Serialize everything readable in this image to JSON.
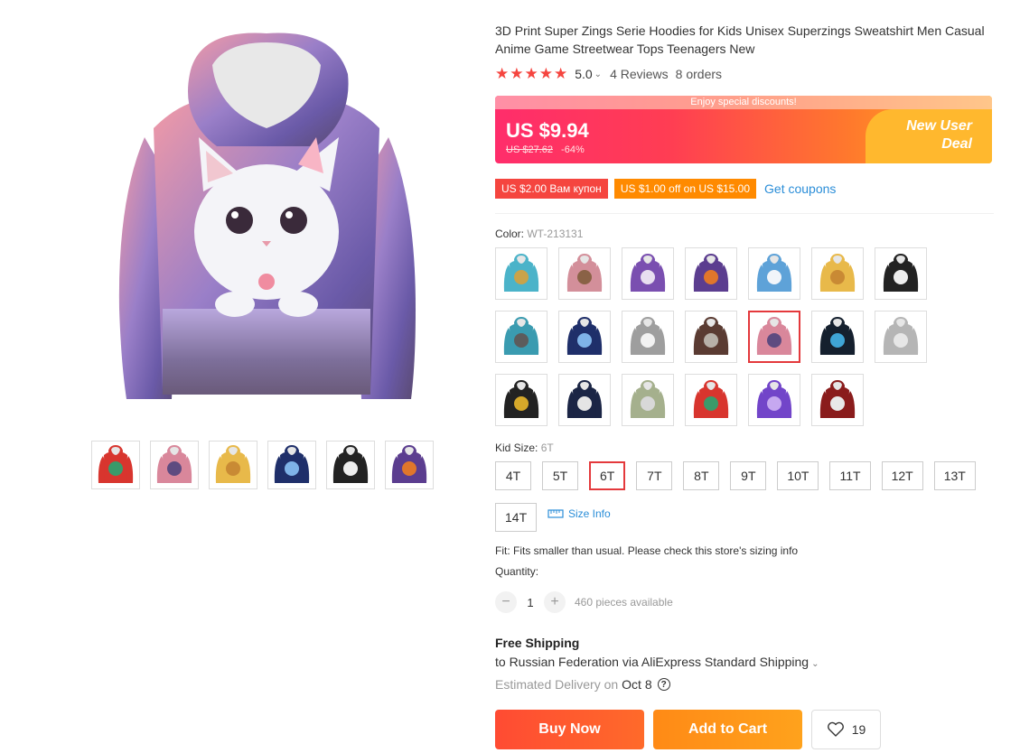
{
  "product": {
    "title": "3D Print Super Zings Serie Hoodies for Kids Unisex Superzings Sweatshirt Men Casual Anime Game Streetwear Tops Teenagers New",
    "rating": "5.0",
    "stars": "★★★★★",
    "reviews": "4 Reviews",
    "orders": "8 orders"
  },
  "promo": {
    "banner_text": "Enjoy special discounts!",
    "price": "US $9.94",
    "original_price": "US $27.62",
    "discount": "-64%",
    "badge_line1": "New User",
    "badge_line2": "Deal"
  },
  "coupons": {
    "items": [
      "US $2.00 Вам купон",
      "US $1.00 off on US $15.00"
    ],
    "link": "Get coupons"
  },
  "color": {
    "label": "Color:",
    "selected": "WT-213131",
    "selected_index": 11,
    "swatches": [
      {
        "icon": "hoodie-teal-yellow",
        "c1": "#4bb3c9",
        "c2": "#c9a34a"
      },
      {
        "icon": "hoodie-pink-brown",
        "c1": "#d38f9a",
        "c2": "#8a6246"
      },
      {
        "icon": "hoodie-purple-cat",
        "c1": "#7a4fb0",
        "c2": "#e8dff0"
      },
      {
        "icon": "hoodie-purple-pumpkin",
        "c1": "#5b3d8f",
        "c2": "#e0762b"
      },
      {
        "icon": "hoodie-blue-white",
        "c1": "#5ea2d8",
        "c2": "#f1f5fa"
      },
      {
        "icon": "hoodie-yellow-cat",
        "c1": "#e8b94a",
        "c2": "#c98a34"
      },
      {
        "icon": "hoodie-black-cat",
        "c1": "#222222",
        "c2": "#eeeeee"
      },
      {
        "icon": "hoodie-teal-grey",
        "c1": "#3a9bb0",
        "c2": "#5c5c5c"
      },
      {
        "icon": "hoodie-navy-blue",
        "c1": "#1f2f6a",
        "c2": "#7fb3e8"
      },
      {
        "icon": "hoodie-grey-white",
        "c1": "#9e9e9e",
        "c2": "#f2f2f2"
      },
      {
        "icon": "hoodie-brown-grey",
        "c1": "#5a3b32",
        "c2": "#b7b0a8"
      },
      {
        "icon": "hoodie-pink-purple",
        "c1": "#d9879b",
        "c2": "#5e4b80"
      },
      {
        "icon": "hoodie-black-blue",
        "c1": "#15202e",
        "c2": "#3fa5d6"
      },
      {
        "icon": "hoodie-grey-light",
        "c1": "#b5b5b5",
        "c2": "#e6e6e6"
      },
      {
        "icon": "hoodie-black-gold",
        "c1": "#222222",
        "c2": "#d5a82a"
      },
      {
        "icon": "hoodie-navy-white",
        "c1": "#1b2545",
        "c2": "#e5e5e5"
      },
      {
        "icon": "hoodie-green-grey",
        "c1": "#a5b08d",
        "c2": "#d8d8d8"
      },
      {
        "icon": "hoodie-red-multi",
        "c1": "#d8352e",
        "c2": "#3a9a6a"
      },
      {
        "icon": "hoodie-violet-galaxy",
        "c1": "#7245c9",
        "c2": "#c6a8f0"
      },
      {
        "icon": "hoodie-red-white",
        "c1": "#8a1c1c",
        "c2": "#e8e8e8"
      }
    ]
  },
  "size": {
    "label": "Kid Size:",
    "selected": "6T",
    "selected_index": 2,
    "options": [
      "4T",
      "5T",
      "6T",
      "7T",
      "8T",
      "9T",
      "10T",
      "11T",
      "12T",
      "13T",
      "14T"
    ],
    "info_link": "Size Info",
    "fit_note": "Fit: Fits smaller than usual. Please check this store's sizing info"
  },
  "quantity": {
    "label": "Quantity:",
    "value": "1",
    "minus": "−",
    "plus": "+",
    "available": "460 pieces available"
  },
  "shipping": {
    "title": "Free Shipping",
    "to": "to Russian Federation via AliExpress Standard Shipping",
    "estimate_label": "Estimated Delivery on",
    "date": "Oct 8"
  },
  "actions": {
    "buy_now": "Buy Now",
    "add_to_cart": "Add to Cart",
    "wishlist_count": "19"
  },
  "gallery": {
    "thumbnails": [
      {
        "icon": "hoodie-red-multi",
        "c1": "#d8352e",
        "c2": "#3a9a6a"
      },
      {
        "icon": "hoodie-pink-purple",
        "c1": "#d9879b",
        "c2": "#5e4b80"
      },
      {
        "icon": "hoodie-yellow-cat",
        "c1": "#e8b94a",
        "c2": "#c98a34"
      },
      {
        "icon": "hoodie-navy-blue",
        "c1": "#1f2f6a",
        "c2": "#7fb3e8"
      },
      {
        "icon": "hoodie-black-cat",
        "c1": "#222222",
        "c2": "#eeeeee"
      },
      {
        "icon": "hoodie-purple-pumpkin",
        "c1": "#5b3d8f",
        "c2": "#e0762b"
      }
    ]
  },
  "colors": {
    "accent": "#e4393c",
    "link": "#2b8ed8",
    "star": "#f5453f"
  }
}
